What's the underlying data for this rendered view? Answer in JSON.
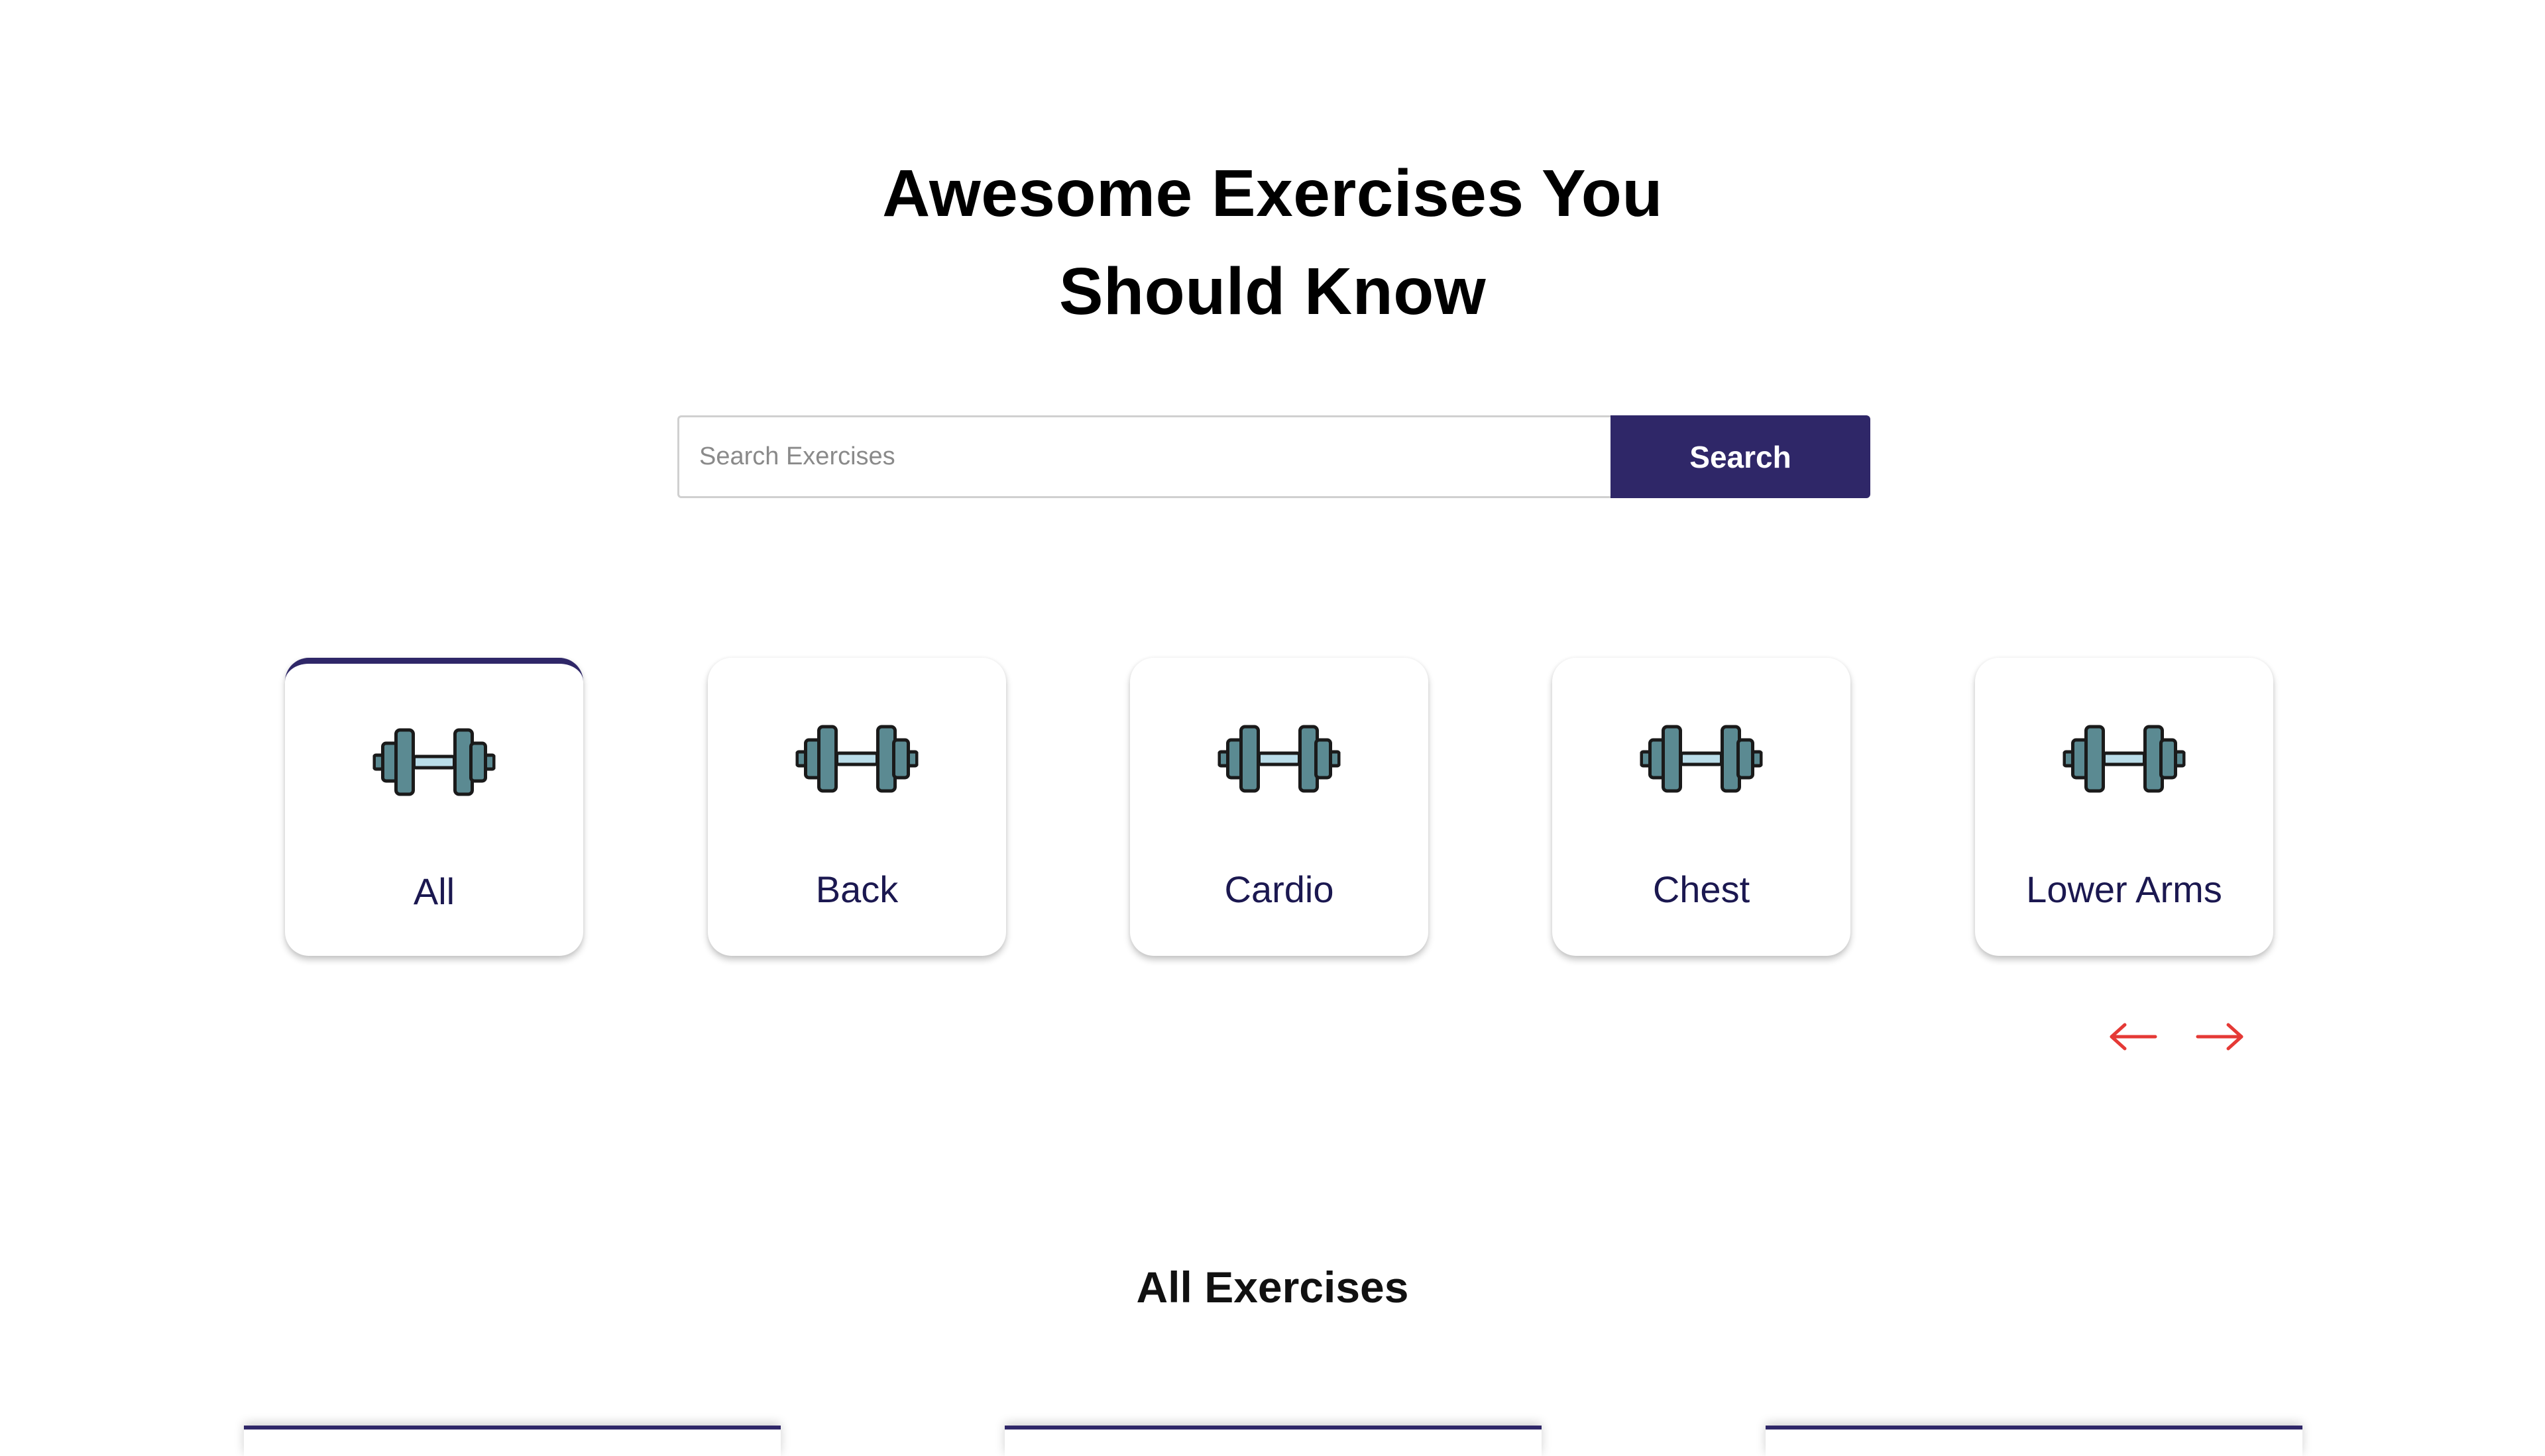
{
  "hero": {
    "title_line1": "Awesome Exercises You",
    "title_line2": "Should Know"
  },
  "search": {
    "placeholder": "Search Exercises",
    "value": "",
    "button_label": "Search"
  },
  "categories": {
    "items": [
      {
        "label": "All",
        "icon": "dumbbell-icon",
        "active": true
      },
      {
        "label": "Back",
        "icon": "dumbbell-icon",
        "active": false
      },
      {
        "label": "Cardio",
        "icon": "dumbbell-icon",
        "active": false
      },
      {
        "label": "Chest",
        "icon": "dumbbell-icon",
        "active": false
      },
      {
        "label": "Lower Arms",
        "icon": "dumbbell-icon",
        "active": false
      }
    ],
    "prev_icon": "arrow-left-icon",
    "next_icon": "arrow-right-icon"
  },
  "exercises": {
    "section_title": "All Exercises"
  },
  "colors": {
    "accent": "#2f2768",
    "arrow": "#e53935",
    "category_text": "#1b1850",
    "dumbbell_plate": "#5b8a92",
    "dumbbell_bar": "#b9dce8"
  }
}
